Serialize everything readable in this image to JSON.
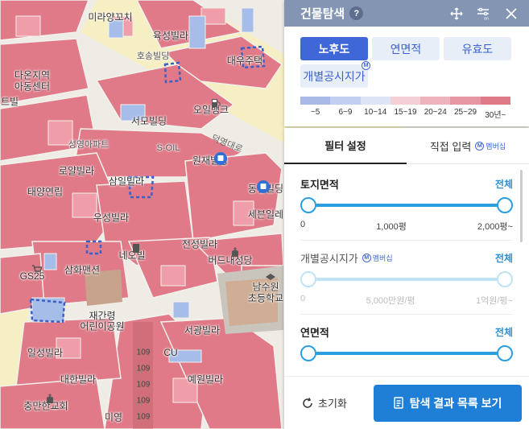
{
  "search_panel": {
    "title": "건물탐색",
    "help_icon": "?",
    "modes": [
      {
        "label": "노후도",
        "active": true
      },
      {
        "label": "연면적",
        "active": false
      },
      {
        "label": "유효도",
        "active": false
      }
    ],
    "mode_extra": {
      "label": "개별공시지가",
      "badge": "M"
    },
    "legend": {
      "colors": [
        "#a9b9e6",
        "#c3cff0",
        "#dde4f5",
        "#f4d0d6",
        "#eeb3bd",
        "#e695a2",
        "#df7a89"
      ],
      "labels": [
        "~5",
        "6~9",
        "10~14",
        "15~19",
        "20~24",
        "25~29",
        "30년~"
      ]
    }
  },
  "filter_panel": {
    "tabs": [
      {
        "label": "필터 설정",
        "active": true
      },
      {
        "label": "직접 입력",
        "active": false,
        "badge": "멤버십"
      }
    ],
    "filters": [
      {
        "title": "토지면적",
        "all_label": "전체",
        "ticks": [
          "0",
          "1,000평",
          "2,000평~"
        ],
        "disabled": false
      },
      {
        "title": "개별공시지가",
        "badge": "멤버십",
        "all_label": "전체",
        "ticks": [
          "0",
          "5,000만원/평",
          "1억원/평~"
        ],
        "disabled": true
      },
      {
        "title": "연면적",
        "all_label": "전체",
        "ticks": [],
        "disabled": false
      }
    ],
    "reset_label": "초기화",
    "list_button_label": "탐색 결과 목록 보기"
  },
  "map": {
    "labels": [
      {
        "text": "미라양꼬치"
      },
      {
        "text": "육성빌라"
      },
      {
        "text": "호송빌딩"
      },
      {
        "text": "다온지역"
      },
      {
        "text": "아동센터"
      },
      {
        "text": "대우주택"
      },
      {
        "text": "트빌"
      },
      {
        "text": "오일뱅크"
      },
      {
        "text": "서모빌딩"
      },
      {
        "text": "성영아파트"
      },
      {
        "text": "S-OIL"
      },
      {
        "text": "원재빌딩"
      },
      {
        "text": "로얄빌라"
      },
      {
        "text": "삼일빌라"
      },
      {
        "text": "태양연립"
      },
      {
        "text": "동일빌딩"
      },
      {
        "text": "세븐일레"
      },
      {
        "text": "우성빌라"
      },
      {
        "text": "전성빌라"
      },
      {
        "text": "네오빌"
      },
      {
        "text": "삼화맨션"
      },
      {
        "text": "버드내성당"
      },
      {
        "text": "GS25"
      },
      {
        "text": "남수원"
      },
      {
        "text": "초등학교"
      },
      {
        "text": "재간령"
      },
      {
        "text": "어린이공원"
      },
      {
        "text": "서광빌라"
      },
      {
        "text": "일성빌라"
      },
      {
        "text": "CU"
      },
      {
        "text": "예원빌라"
      },
      {
        "text": "대한빌라"
      },
      {
        "text": "충만한교회"
      },
      {
        "text": "미영"
      }
    ],
    "road": "덕영대로",
    "numbers": [
      "109",
      "109",
      "109",
      "109",
      "109"
    ]
  }
}
